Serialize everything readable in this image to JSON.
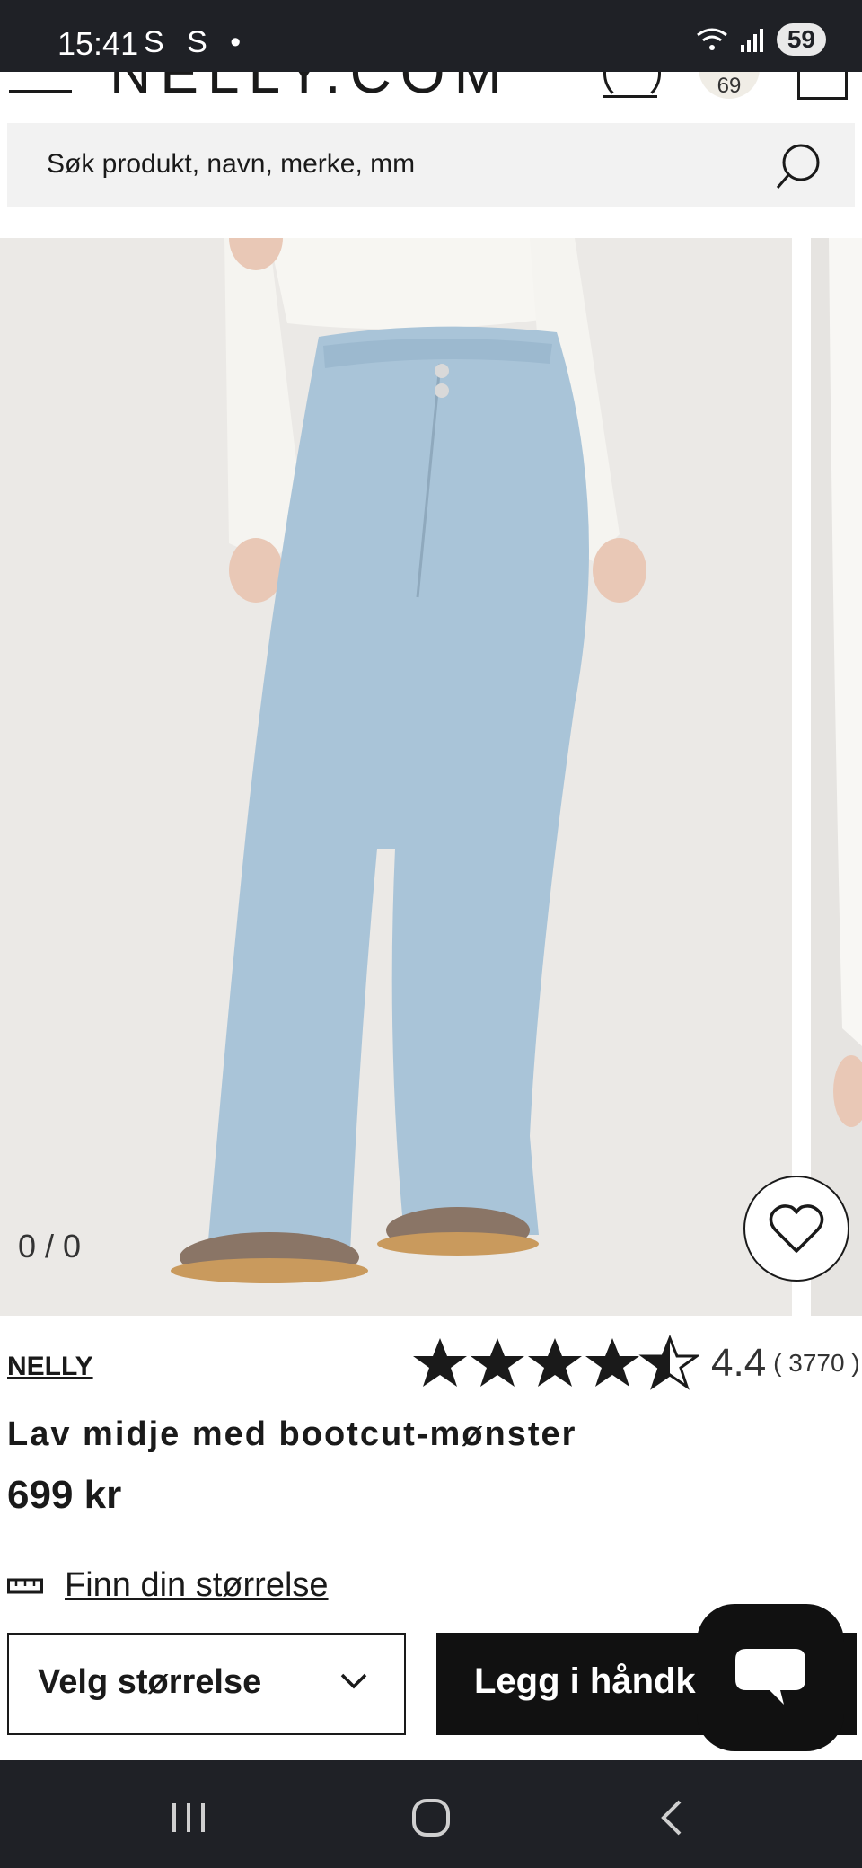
{
  "status_bar": {
    "time": "15:41",
    "icons_left": "S S •",
    "battery": "59"
  },
  "header": {
    "logo": "NELLY.COM",
    "wishlist_count": "69"
  },
  "search": {
    "placeholder": "Søk produkt, navn, merke, mm"
  },
  "gallery": {
    "counter": "0 / 0"
  },
  "product": {
    "brand": "NELLY",
    "rating": 4.4,
    "rating_text": "4.4",
    "review_count": "( 3770 )",
    "title": "Lav midje med bootcut-mønster",
    "price": "699 kr"
  },
  "size_guide": {
    "label": "Finn din størrelse"
  },
  "actions": {
    "select_size": "Velg størrelse",
    "add_to_cart": "Legg i håndkurv"
  },
  "colors": {
    "dark": "#111111",
    "statusbar": "#1f2126",
    "denim": "#a9c4d8"
  }
}
